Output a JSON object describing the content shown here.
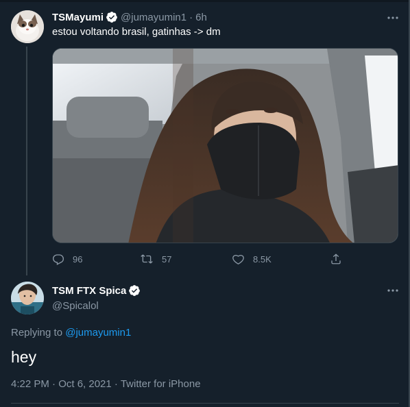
{
  "tweet": {
    "display_name": "TSMayumi",
    "handle": "@jumayumin1",
    "separator": "·",
    "time": "6h",
    "text": "estou voltando brasil, gatinhas -> dm",
    "actions": {
      "replies": "96",
      "retweets": "57",
      "likes": "8.5K"
    }
  },
  "reply": {
    "display_name": "TSM FTX Spica",
    "handle": "@Spicalol",
    "replying_prefix": "Replying to",
    "replying_to": "@jumayumin1",
    "text": "hey",
    "date": "4:22 PM · Oct 6, 2021",
    "separator": "·",
    "source": "Twitter for iPhone"
  },
  "colors": {
    "background": "#15202b",
    "border": "#38444d",
    "secondary_text": "#8b98a5",
    "link": "#1d9bf0",
    "verified": "#ffffff"
  },
  "icons": {
    "verified": "verified-badge-icon",
    "more": "more-dots-icon",
    "reply": "reply-icon",
    "retweet": "retweet-icon",
    "like": "heart-icon",
    "share": "share-icon"
  }
}
